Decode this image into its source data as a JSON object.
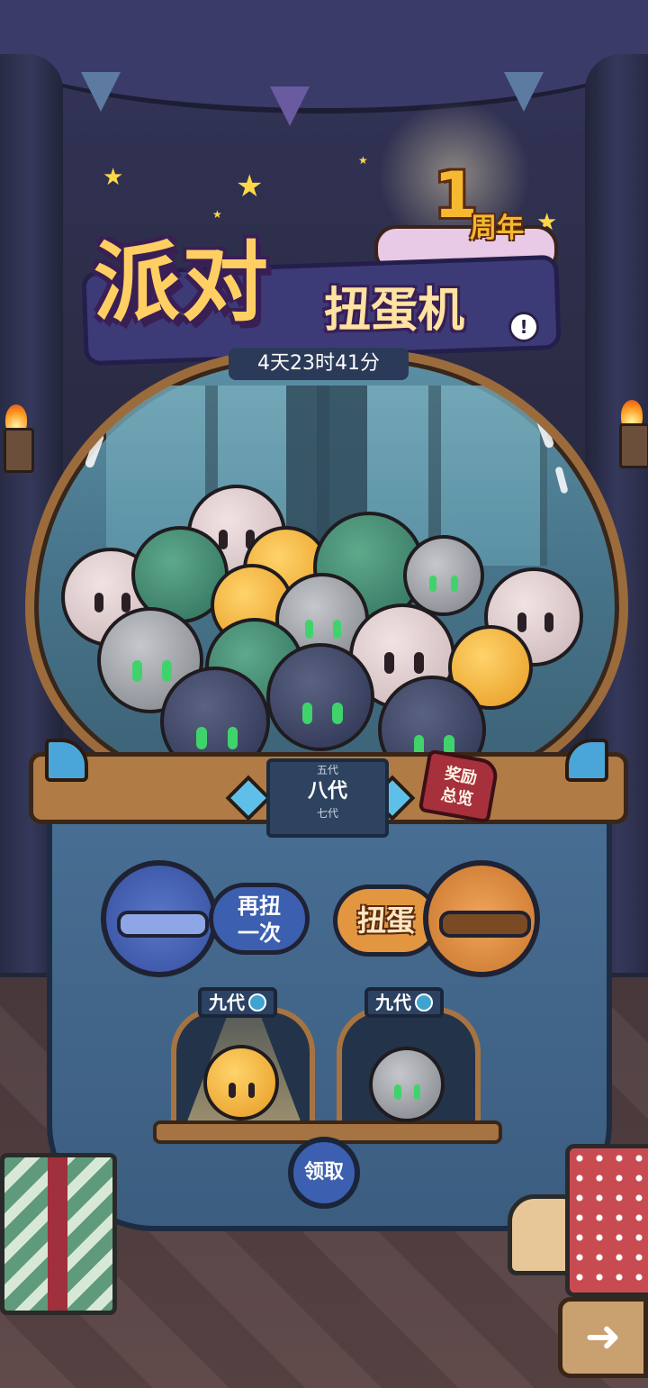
{
  "title": {
    "main": "派对",
    "sub": "扭蛋机",
    "anniversary_number": "1",
    "anniversary_text": "周年"
  },
  "timer": "4天23时41分",
  "generation_selector": {
    "prev": "五代",
    "current": "八代",
    "next": "七代"
  },
  "reward_overview": "奖励\n总览",
  "buttons": {
    "spin_again": "再扭\n一次",
    "spin": "扭蛋",
    "claim": "领取"
  },
  "trays": [
    {
      "label": "九代"
    },
    {
      "label": "九代"
    }
  ],
  "icons": {
    "info": "info-icon",
    "magnifier": "magnifier-icon",
    "next": "arrow-icon"
  },
  "colors": {
    "title": "#ffcf63",
    "accent_blue": "#3c5fb0",
    "accent_orange": "#e2963f"
  }
}
